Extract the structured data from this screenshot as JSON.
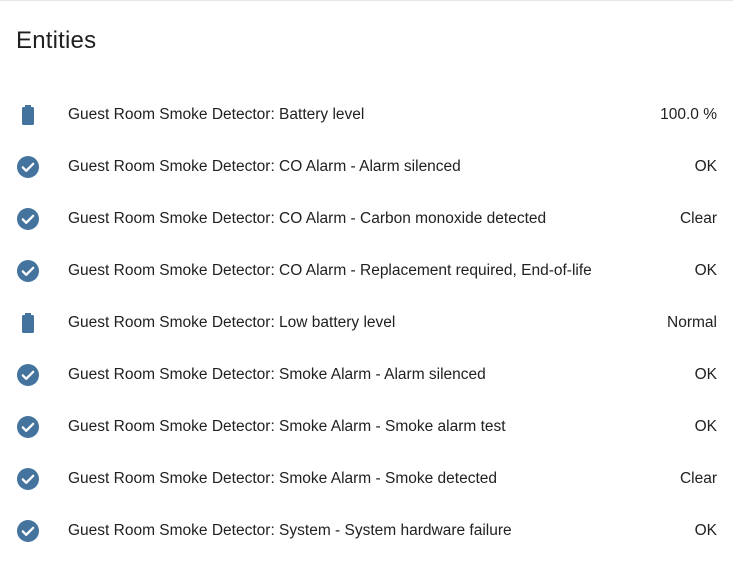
{
  "card": {
    "title": "Entities"
  },
  "colors": {
    "icon": "#44739e",
    "text": "#212121"
  },
  "entities": [
    {
      "icon": "battery-icon",
      "name": "Guest Room Smoke Detector: Battery level",
      "state": "100.0 %"
    },
    {
      "icon": "check-circle-icon",
      "name": "Guest Room Smoke Detector: CO Alarm - Alarm silenced",
      "state": "OK"
    },
    {
      "icon": "check-circle-icon",
      "name": "Guest Room Smoke Detector: CO Alarm - Carbon monoxide detected",
      "state": "Clear"
    },
    {
      "icon": "check-circle-icon",
      "name": "Guest Room Smoke Detector: CO Alarm - Replacement required, End-of-life",
      "state": "OK"
    },
    {
      "icon": "battery-icon",
      "name": "Guest Room Smoke Detector: Low battery level",
      "state": "Normal"
    },
    {
      "icon": "check-circle-icon",
      "name": "Guest Room Smoke Detector: Smoke Alarm - Alarm silenced",
      "state": "OK"
    },
    {
      "icon": "check-circle-icon",
      "name": "Guest Room Smoke Detector: Smoke Alarm - Smoke alarm test",
      "state": "OK"
    },
    {
      "icon": "check-circle-icon",
      "name": "Guest Room Smoke Detector: Smoke Alarm - Smoke detected",
      "state": "Clear"
    },
    {
      "icon": "check-circle-icon",
      "name": "Guest Room Smoke Detector: System - System hardware failure",
      "state": "OK"
    }
  ]
}
